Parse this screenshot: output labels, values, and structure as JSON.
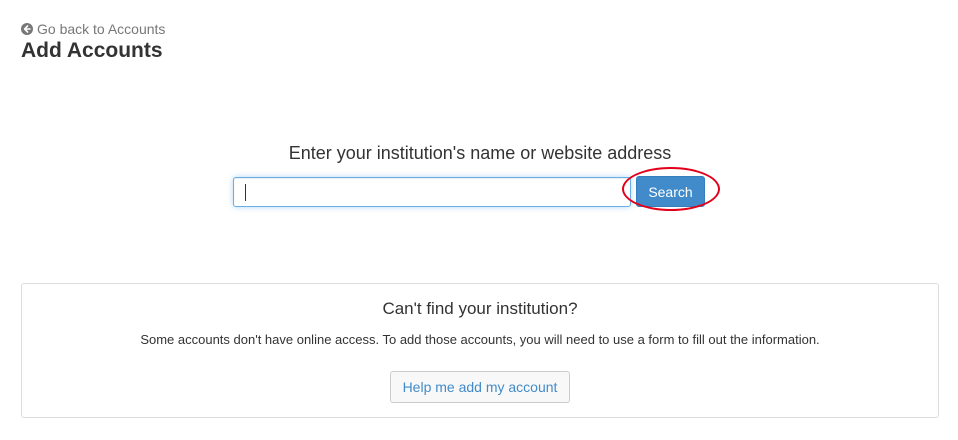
{
  "header": {
    "back_link_label": "Go back to Accounts",
    "back_icon": "arrow-circle-left-icon",
    "title": "Add Accounts"
  },
  "search": {
    "prompt": "Enter your institution's name or website address",
    "input_value": "",
    "input_placeholder": "",
    "button_label": "Search"
  },
  "annotation": {
    "highlight_color": "#e3001b"
  },
  "cant_find": {
    "heading": "Can't find your institution?",
    "description": "Some accounts don't have online access. To add those accounts, you will need to use a form to fill out the information.",
    "button_label": "Help me add my account"
  },
  "colors": {
    "primary": "#428bca",
    "link_muted": "#777777",
    "text": "#333333"
  }
}
